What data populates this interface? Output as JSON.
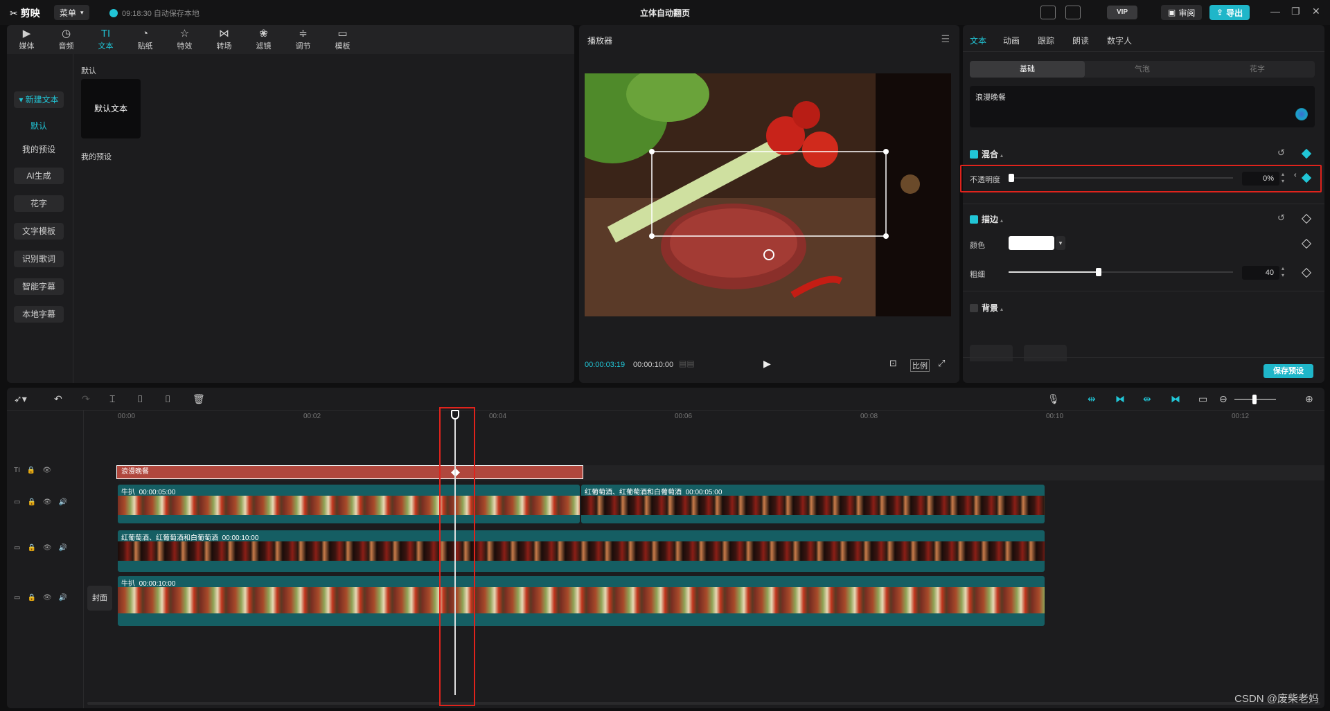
{
  "titlebar": {
    "app_name": "剪映",
    "menu_label": "菜单",
    "save_status": "09:18:30 自动保存本地",
    "title": "立体自动翻页",
    "vip_label": "VIP",
    "review_label": "审阅",
    "export_label": "导出"
  },
  "media": {
    "tools": [
      {
        "label": "媒体",
        "icon": "▶"
      },
      {
        "label": "音频",
        "icon": "◷"
      },
      {
        "label": "文本",
        "icon": "TI"
      },
      {
        "label": "贴纸",
        "icon": "◔"
      },
      {
        "label": "特效",
        "icon": "☆"
      },
      {
        "label": "转场",
        "icon": "⋈"
      },
      {
        "label": "滤镜",
        "icon": "❀"
      },
      {
        "label": "调节",
        "icon": "≑"
      },
      {
        "label": "模板",
        "icon": "▭"
      }
    ],
    "sidebar": {
      "new_text": "新建文本",
      "default": "默认",
      "my_presets": "我的预设",
      "ai": "AI生成",
      "fancy": "花字",
      "template": "文字模板",
      "lyrics": "识别歌词",
      "smart_sub": "智能字幕",
      "local_sub": "本地字幕"
    },
    "section_default": "默认",
    "card_label": "默认文本",
    "section_presets": "我的预设"
  },
  "player": {
    "title": "播放器",
    "time_current": "00:00:03:19",
    "time_total": "00:00:10:00",
    "ratio_label": "比例"
  },
  "props": {
    "tabs": [
      "文本",
      "动画",
      "跟踪",
      "朗读",
      "数字人"
    ],
    "segments": [
      "基础",
      "气泡",
      "花字"
    ],
    "text_value": "浪漫晚餐",
    "blend": {
      "title": "混合",
      "opacity_label": "不透明度",
      "opacity_value": "0%",
      "opacity_fraction": 0.0
    },
    "stroke": {
      "title": "描边",
      "color_label": "颜色",
      "width_label": "粗细",
      "width_value": "40",
      "width_fraction": 0.4
    },
    "background": {
      "title": "背景"
    },
    "save_preset": "保存预设"
  },
  "timeline": {
    "ticks": [
      "00:00",
      "00:02",
      "00:04",
      "00:06",
      "00:08",
      "00:10",
      "00:12"
    ],
    "text_clip": "浪漫晚餐",
    "track1": [
      {
        "label": "牛扒",
        "duration": "00:00:05:00"
      },
      {
        "label": "红葡萄酒、红葡萄酒和白葡萄酒",
        "duration": "00:00:05:00"
      }
    ],
    "track2": {
      "label": "红葡萄酒、红葡萄酒和白葡萄酒",
      "duration": "00:00:10:00"
    },
    "track3": {
      "label": "牛扒",
      "duration": "00:00:10:00"
    },
    "cover_label": "封面"
  },
  "watermark": "CSDN @废柴老妈",
  "colors": {
    "accent": "#21c5d6",
    "highlight": "#e0231c",
    "text_clip": "#b0473d",
    "video_clip": "#155e63"
  }
}
